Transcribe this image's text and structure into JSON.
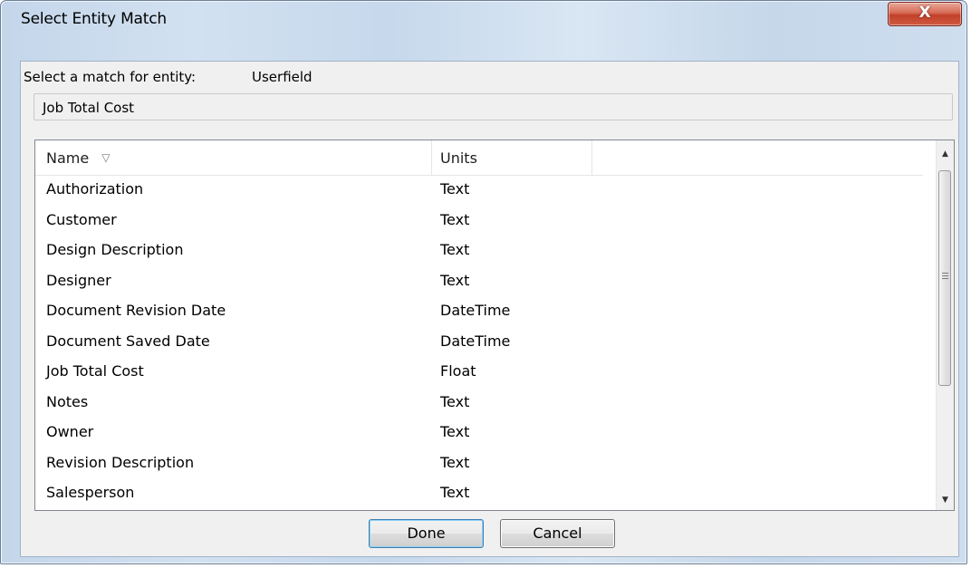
{
  "window": {
    "title": "Select Entity Match",
    "close_glyph": "X"
  },
  "prompt": {
    "label": "Select a match for entity:",
    "entity": "Userfield"
  },
  "field": {
    "value": "Job Total Cost"
  },
  "list": {
    "columns": [
      "Name",
      "Units"
    ],
    "sort_icon": "sort-indicator-icon",
    "rows": [
      {
        "name": "Authorization",
        "units": "Text"
      },
      {
        "name": "Customer",
        "units": "Text"
      },
      {
        "name": "Design Description",
        "units": "Text"
      },
      {
        "name": "Designer",
        "units": "Text"
      },
      {
        "name": "Document Revision Date",
        "units": "DateTime"
      },
      {
        "name": "Document Saved Date",
        "units": "DateTime"
      },
      {
        "name": "Job Total Cost",
        "units": "Float"
      },
      {
        "name": "Notes",
        "units": "Text"
      },
      {
        "name": "Owner",
        "units": "Text"
      },
      {
        "name": "Revision Description",
        "units": "Text"
      },
      {
        "name": "Salesperson",
        "units": "Text"
      }
    ]
  },
  "buttons": {
    "done": "Done",
    "cancel": "Cancel"
  },
  "colors": {
    "close_button": "#c2402a",
    "default_button_border": "#3c7fb1"
  }
}
